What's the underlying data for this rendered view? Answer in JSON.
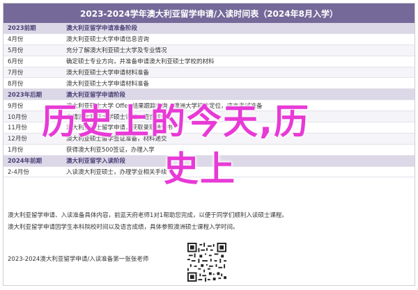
{
  "title": "2023-2024学年澳大利亚留学申请/入读时间表（2024年8月入学）",
  "rows": [
    {
      "type": "section",
      "date": "2023前期",
      "text": "澳大利亚留学申请准备阶段"
    },
    {
      "type": "row",
      "date": "4月份",
      "text": "澳大利亚硕士大学申请信息咨询"
    },
    {
      "type": "row",
      "date": "5月份",
      "text": "充分了解澳大利亚硕士大学及专业情况"
    },
    {
      "type": "row",
      "date": "6月份",
      "text": "确定硕士专业方向，并准备申请澳大利亚硕士学校的材料"
    },
    {
      "type": "row",
      "date": "7月份",
      "text": "澳大利亚硕士大学申请材料准备"
    },
    {
      "type": "row",
      "date": "8月份",
      "text": "澳大利亚硕士大学申请材料准备"
    },
    {
      "type": "section",
      "date": "2023年后期",
      "text": "澳大利亚留学申请阶段"
    },
    {
      "type": "row",
      "date": "9月份",
      "text": "澳大利亚硕士大学 Offer 结果跟踪查询，澳洲大学初步定位，语言考试准备"
    },
    {
      "type": "row",
      "date": "10月份",
      "text": "申请澳大利亚大学硕士课程，语言成绩"
    },
    {
      "type": "row",
      "date": "11月份",
      "text": "澳大利亚硕士留学申请，获取录取通知书"
    },
    {
      "type": "row",
      "date": "12月份",
      "text": "澳大利亚硕士留学签证准备，材料递交"
    },
    {
      "type": "row",
      "date": "1月份",
      "text": "获得澳大利亚500签证，办理入学"
    },
    {
      "type": "section",
      "date": "2024年前期",
      "text": "澳大利亚留学入读阶段"
    },
    {
      "type": "row",
      "date": "2-4月份",
      "text": "入读澳大利亚硕士，办理学业相关手续"
    }
  ],
  "notes": [
    "澳大利亚留学申请、入读准备具体内容，前蓝天府老师1对1帮助您完成，以便于同学们顺利入读硕士课程。",
    "澳大利亚留学申请因学生本科院校时间以及语言成绩，具体参照澳洲硕士课程入学时间。"
  ],
  "footer": "2023-2024澳大利亚留学申请/入读准备第一张张老师",
  "overlay_line1": "历史上的今天,历",
  "overlay_line2": "史上",
  "colors": {
    "header": "#75699a",
    "section": "#dcd8e7",
    "overlay": "#e83ad6"
  }
}
